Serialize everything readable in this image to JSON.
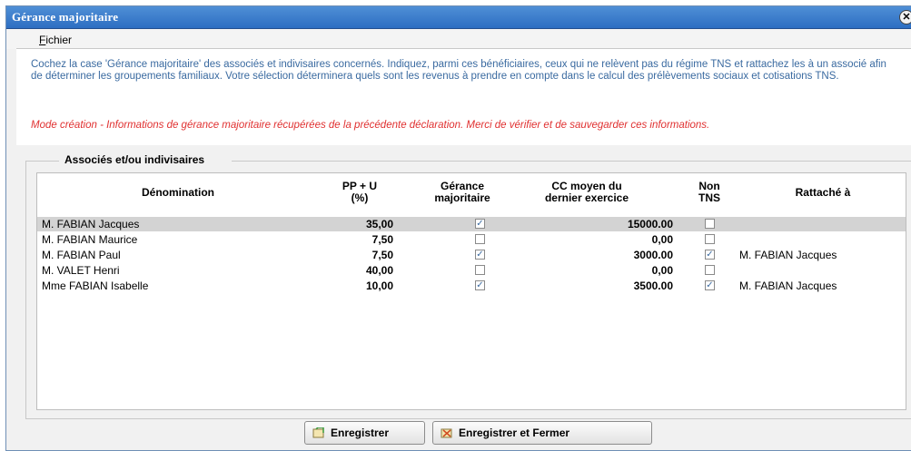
{
  "window": {
    "title": "Gérance majoritaire"
  },
  "menu": {
    "fichier_first": "F",
    "fichier_rest": "ichier"
  },
  "info": {
    "main": "Cochez la case 'Gérance majoritaire' des associés et indivisaires concernés. Indiquez, parmi ces bénéficiaires, ceux qui ne relèvent pas du régime TNS et rattachez les à un associé afin de déterminer les groupements familiaux. Votre sélection déterminera quels sont les revenus à prendre en compte dans le calcul des prélèvements sociaux et cotisations TNS.",
    "warning": "Mode création - Informations de gérance majoritaire récupérées de la précédente déclaration. Merci de vérifier et de sauvegarder ces informations."
  },
  "group": {
    "legend": "Associés et/ou indivisaires"
  },
  "table": {
    "headers": {
      "denomination": "Dénomination",
      "ppu": "PP + U\n(%)",
      "gerance": "Gérance\nmajoritaire",
      "cc": "CC moyen du\ndernier exercice",
      "nontns": "Non\nTNS",
      "rattache": "Rattaché à"
    },
    "rows": [
      {
        "name": "M. FABIAN Jacques",
        "ppu": "35,00",
        "gerance": true,
        "cc": "15000.00",
        "nontns": false,
        "rattache": "",
        "selected": true
      },
      {
        "name": "M. FABIAN Maurice",
        "ppu": "7,50",
        "gerance": false,
        "cc": "0,00",
        "nontns": false,
        "rattache": "",
        "selected": false
      },
      {
        "name": "M. FABIAN Paul",
        "ppu": "7,50",
        "gerance": true,
        "cc": "3000.00",
        "nontns": true,
        "rattache": "M. FABIAN Jacques",
        "selected": false
      },
      {
        "name": "M. VALET Henri",
        "ppu": "40,00",
        "gerance": false,
        "cc": "0,00",
        "nontns": false,
        "rattache": "",
        "selected": false
      },
      {
        "name": "Mme FABIAN Isabelle",
        "ppu": "10,00",
        "gerance": true,
        "cc": "3500.00",
        "nontns": true,
        "rattache": "M. FABIAN Jacques",
        "selected": false
      }
    ]
  },
  "buttons": {
    "save": "Enregistrer",
    "save_close": "Enregistrer et Fermer"
  },
  "colors": {
    "title_bar": "#2d6ec2",
    "info_text": "#3a6aa0",
    "warning_text": "#e03030",
    "selected_row": "#d3d3d3"
  },
  "icons": {
    "save": "save-icon",
    "save_close": "save-close-icon",
    "close": "close-icon"
  }
}
